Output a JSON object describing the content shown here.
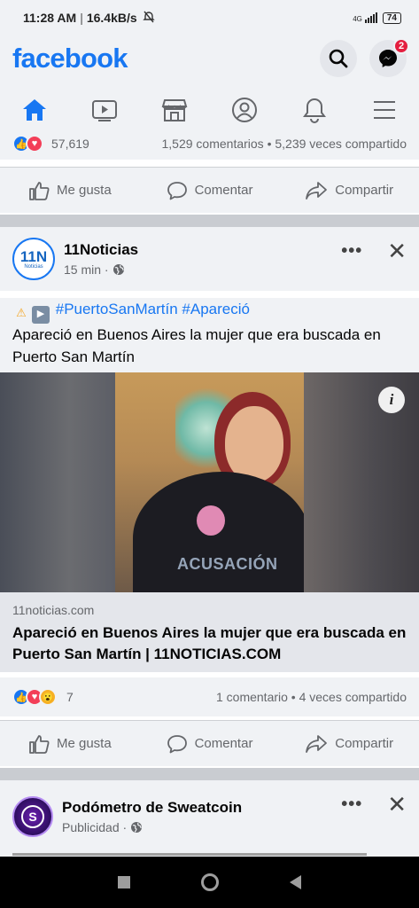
{
  "status_bar": {
    "time": "11:28 AM",
    "network_speed": "16.4kB/s",
    "signal": "4G",
    "battery": "74"
  },
  "header": {
    "logo": "facebook",
    "messenger_badge": "2"
  },
  "tabs": [
    "home",
    "watch",
    "marketplace",
    "profile",
    "notifications",
    "menu"
  ],
  "post1": {
    "reaction_count": "57,619",
    "comments_shares": "1,529 comentarios • 5,239 veces compartido"
  },
  "actions": {
    "like": "Me gusta",
    "comment": "Comentar",
    "share": "Compartir"
  },
  "post2": {
    "page_name": "11Noticias",
    "avatar_text": "11N",
    "avatar_subtext": "Noticias",
    "time": "15 min ·",
    "hashtags": "#PuertoSanMartín #Apareció",
    "text": "Apareció en Buenos Aires la mujer que era buscada en Puerto San Martín",
    "image_watermark": "ACUSACIÓN",
    "link_domain": "11noticias.com",
    "link_title": "Apareció en Buenos Aires la mujer que era buscada en Puerto San Martín | 11NOTICIAS.COM",
    "reaction_count": "7",
    "comments_shares": "1 comentario • 4 veces compartido"
  },
  "post3": {
    "page_name": "Podómetro de Sweatcoin",
    "label": "Publicidad ·"
  },
  "colors": {
    "brand_blue": "#1877f2",
    "background": "#f0f2f5",
    "badge_red": "#e41e3f"
  }
}
